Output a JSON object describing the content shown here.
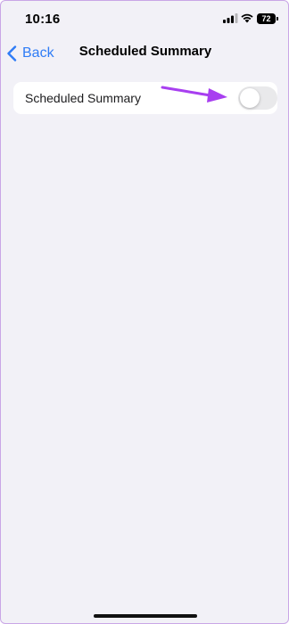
{
  "status_bar": {
    "time": "10:16",
    "battery_level": "72",
    "icons": [
      "signal-icon",
      "wifi-icon",
      "battery-icon"
    ]
  },
  "nav": {
    "back_label": "Back",
    "title": "Scheduled Summary"
  },
  "settings": {
    "rows": [
      {
        "label": "Scheduled Summary",
        "toggle_on": false
      }
    ]
  },
  "colors": {
    "background": "#f2f1f7",
    "accent_blue": "#2f7cf6",
    "annotation_purple": "#a83ff0",
    "toggle_off": "#e9e9eb"
  }
}
